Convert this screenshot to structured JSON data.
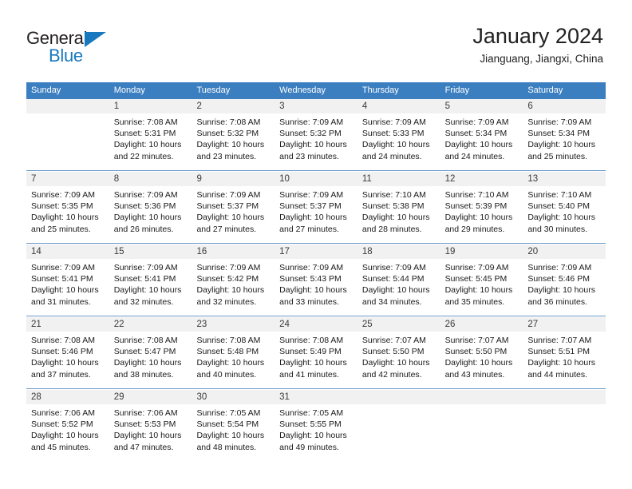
{
  "brand": {
    "name_part1": "General",
    "name_part2": "Blue",
    "accent_color": "#1878be"
  },
  "header": {
    "title": "January 2024",
    "subtitle": "Jianguang, Jiangxi, China"
  },
  "theme": {
    "header_row_color": "#3c7fc1",
    "daynum_band_color": "#f1f1f1",
    "week_separator_color": "#6b9bc9"
  },
  "weekdays": [
    "Sunday",
    "Monday",
    "Tuesday",
    "Wednesday",
    "Thursday",
    "Friday",
    "Saturday"
  ],
  "weeks": [
    [
      {
        "day": "",
        "lines": []
      },
      {
        "day": "1",
        "lines": [
          "Sunrise: 7:08 AM",
          "Sunset: 5:31 PM",
          "Daylight: 10 hours",
          "and 22 minutes."
        ]
      },
      {
        "day": "2",
        "lines": [
          "Sunrise: 7:08 AM",
          "Sunset: 5:32 PM",
          "Daylight: 10 hours",
          "and 23 minutes."
        ]
      },
      {
        "day": "3",
        "lines": [
          "Sunrise: 7:09 AM",
          "Sunset: 5:32 PM",
          "Daylight: 10 hours",
          "and 23 minutes."
        ]
      },
      {
        "day": "4",
        "lines": [
          "Sunrise: 7:09 AM",
          "Sunset: 5:33 PM",
          "Daylight: 10 hours",
          "and 24 minutes."
        ]
      },
      {
        "day": "5",
        "lines": [
          "Sunrise: 7:09 AM",
          "Sunset: 5:34 PM",
          "Daylight: 10 hours",
          "and 24 minutes."
        ]
      },
      {
        "day": "6",
        "lines": [
          "Sunrise: 7:09 AM",
          "Sunset: 5:34 PM",
          "Daylight: 10 hours",
          "and 25 minutes."
        ]
      }
    ],
    [
      {
        "day": "7",
        "lines": [
          "Sunrise: 7:09 AM",
          "Sunset: 5:35 PM",
          "Daylight: 10 hours",
          "and 25 minutes."
        ]
      },
      {
        "day": "8",
        "lines": [
          "Sunrise: 7:09 AM",
          "Sunset: 5:36 PM",
          "Daylight: 10 hours",
          "and 26 minutes."
        ]
      },
      {
        "day": "9",
        "lines": [
          "Sunrise: 7:09 AM",
          "Sunset: 5:37 PM",
          "Daylight: 10 hours",
          "and 27 minutes."
        ]
      },
      {
        "day": "10",
        "lines": [
          "Sunrise: 7:09 AM",
          "Sunset: 5:37 PM",
          "Daylight: 10 hours",
          "and 27 minutes."
        ]
      },
      {
        "day": "11",
        "lines": [
          "Sunrise: 7:10 AM",
          "Sunset: 5:38 PM",
          "Daylight: 10 hours",
          "and 28 minutes."
        ]
      },
      {
        "day": "12",
        "lines": [
          "Sunrise: 7:10 AM",
          "Sunset: 5:39 PM",
          "Daylight: 10 hours",
          "and 29 minutes."
        ]
      },
      {
        "day": "13",
        "lines": [
          "Sunrise: 7:10 AM",
          "Sunset: 5:40 PM",
          "Daylight: 10 hours",
          "and 30 minutes."
        ]
      }
    ],
    [
      {
        "day": "14",
        "lines": [
          "Sunrise: 7:09 AM",
          "Sunset: 5:41 PM",
          "Daylight: 10 hours",
          "and 31 minutes."
        ]
      },
      {
        "day": "15",
        "lines": [
          "Sunrise: 7:09 AM",
          "Sunset: 5:41 PM",
          "Daylight: 10 hours",
          "and 32 minutes."
        ]
      },
      {
        "day": "16",
        "lines": [
          "Sunrise: 7:09 AM",
          "Sunset: 5:42 PM",
          "Daylight: 10 hours",
          "and 32 minutes."
        ]
      },
      {
        "day": "17",
        "lines": [
          "Sunrise: 7:09 AM",
          "Sunset: 5:43 PM",
          "Daylight: 10 hours",
          "and 33 minutes."
        ]
      },
      {
        "day": "18",
        "lines": [
          "Sunrise: 7:09 AM",
          "Sunset: 5:44 PM",
          "Daylight: 10 hours",
          "and 34 minutes."
        ]
      },
      {
        "day": "19",
        "lines": [
          "Sunrise: 7:09 AM",
          "Sunset: 5:45 PM",
          "Daylight: 10 hours",
          "and 35 minutes."
        ]
      },
      {
        "day": "20",
        "lines": [
          "Sunrise: 7:09 AM",
          "Sunset: 5:46 PM",
          "Daylight: 10 hours",
          "and 36 minutes."
        ]
      }
    ],
    [
      {
        "day": "21",
        "lines": [
          "Sunrise: 7:08 AM",
          "Sunset: 5:46 PM",
          "Daylight: 10 hours",
          "and 37 minutes."
        ]
      },
      {
        "day": "22",
        "lines": [
          "Sunrise: 7:08 AM",
          "Sunset: 5:47 PM",
          "Daylight: 10 hours",
          "and 38 minutes."
        ]
      },
      {
        "day": "23",
        "lines": [
          "Sunrise: 7:08 AM",
          "Sunset: 5:48 PM",
          "Daylight: 10 hours",
          "and 40 minutes."
        ]
      },
      {
        "day": "24",
        "lines": [
          "Sunrise: 7:08 AM",
          "Sunset: 5:49 PM",
          "Daylight: 10 hours",
          "and 41 minutes."
        ]
      },
      {
        "day": "25",
        "lines": [
          "Sunrise: 7:07 AM",
          "Sunset: 5:50 PM",
          "Daylight: 10 hours",
          "and 42 minutes."
        ]
      },
      {
        "day": "26",
        "lines": [
          "Sunrise: 7:07 AM",
          "Sunset: 5:50 PM",
          "Daylight: 10 hours",
          "and 43 minutes."
        ]
      },
      {
        "day": "27",
        "lines": [
          "Sunrise: 7:07 AM",
          "Sunset: 5:51 PM",
          "Daylight: 10 hours",
          "and 44 minutes."
        ]
      }
    ],
    [
      {
        "day": "28",
        "lines": [
          "Sunrise: 7:06 AM",
          "Sunset: 5:52 PM",
          "Daylight: 10 hours",
          "and 45 minutes."
        ]
      },
      {
        "day": "29",
        "lines": [
          "Sunrise: 7:06 AM",
          "Sunset: 5:53 PM",
          "Daylight: 10 hours",
          "and 47 minutes."
        ]
      },
      {
        "day": "30",
        "lines": [
          "Sunrise: 7:05 AM",
          "Sunset: 5:54 PM",
          "Daylight: 10 hours",
          "and 48 minutes."
        ]
      },
      {
        "day": "31",
        "lines": [
          "Sunrise: 7:05 AM",
          "Sunset: 5:55 PM",
          "Daylight: 10 hours",
          "and 49 minutes."
        ]
      },
      {
        "day": "",
        "lines": []
      },
      {
        "day": "",
        "lines": []
      },
      {
        "day": "",
        "lines": []
      }
    ]
  ]
}
